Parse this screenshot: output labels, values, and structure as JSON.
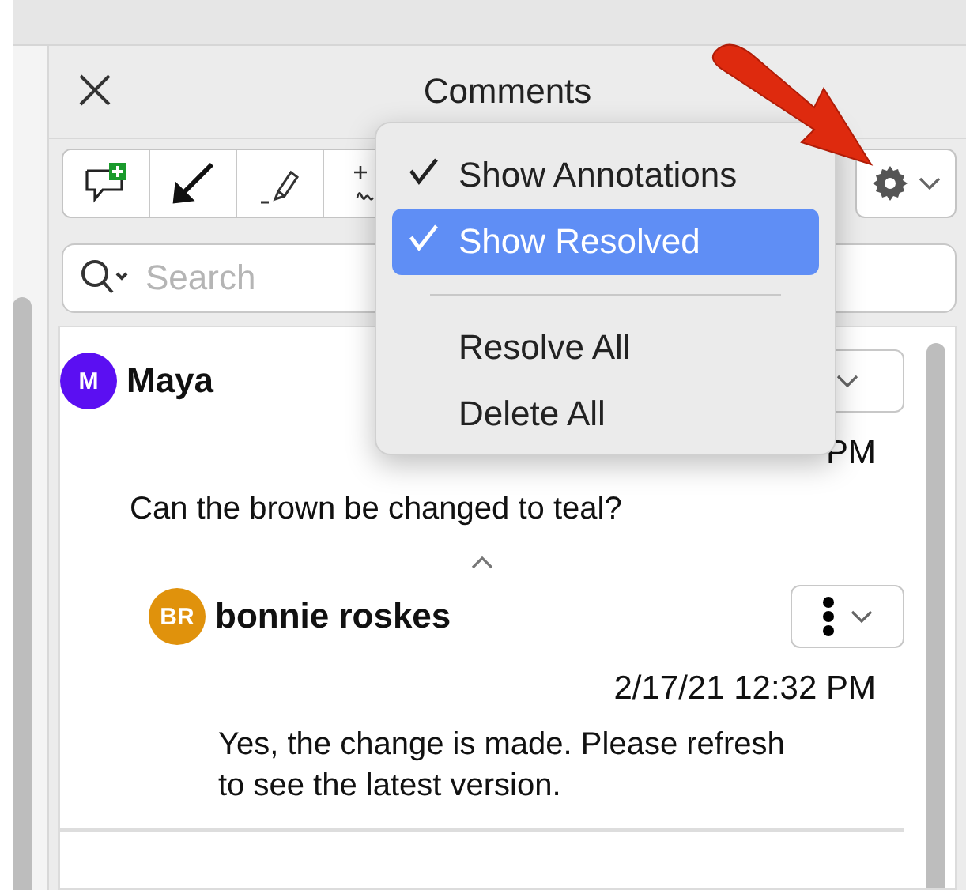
{
  "panel": {
    "title": "Comments"
  },
  "toolbar": {
    "tools": [
      {
        "kind": "add-comment"
      },
      {
        "kind": "arrow"
      },
      {
        "kind": "highlighter"
      },
      {
        "kind": "freehand"
      }
    ]
  },
  "search": {
    "placeholder": "Search"
  },
  "comments": [
    {
      "author": "Maya",
      "initials": "M",
      "color": "#5b0ff2",
      "time": "PM",
      "text": "Can the brown be changed to teal?",
      "expanded": true,
      "more_icon": false,
      "replies": [
        {
          "author": "bonnie roskes",
          "initials": "BR",
          "color": "#e0920c",
          "time": "2/17/21 12:32 PM",
          "text": "Yes, the change is made. Please refresh to see the latest version.",
          "more_icon": true
        }
      ]
    }
  ],
  "menu": {
    "items": [
      {
        "kind": "item",
        "label": "Show Annotations",
        "checked": true,
        "selected": false
      },
      {
        "kind": "item",
        "label": "Show Resolved",
        "checked": true,
        "selected": true
      },
      {
        "kind": "separator"
      },
      {
        "kind": "item",
        "label": "Resolve All",
        "checked": false,
        "selected": false
      },
      {
        "kind": "item",
        "label": "Delete All",
        "checked": false,
        "selected": false
      }
    ]
  }
}
